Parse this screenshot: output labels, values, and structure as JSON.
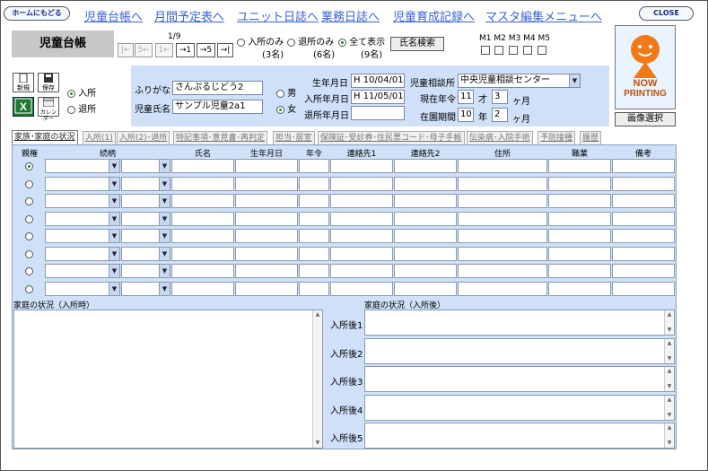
{
  "nav": {
    "home_label": "ホームにもどる",
    "close_label": "CLOSE",
    "links": [
      "児童台帳へ",
      "月間予定表へ",
      "ユニット日誌へ",
      "業務日誌へ",
      "児童育成記録へ",
      "マスタ編集メニューへ"
    ]
  },
  "page_title": "児童台帳",
  "pager": {
    "count": "1/9",
    "buttons": [
      "|←",
      "5←",
      "1←",
      "→1",
      "→5",
      "→|"
    ]
  },
  "filter": {
    "options": [
      {
        "label": "入所のみ",
        "count": "(3名)",
        "checked": false
      },
      {
        "label": "退所のみ",
        "count": "(6名)",
        "checked": false
      },
      {
        "label": "全て表示",
        "count": "(9名)",
        "checked": true
      }
    ],
    "search_button": "氏名検索"
  },
  "m_checks": [
    "M1",
    "M2",
    "M3",
    "M4",
    "M5"
  ],
  "tools": {
    "new_label": "新規",
    "save_label": "保存",
    "calendar_label": "カレンダー",
    "status_options": [
      {
        "label": "入所",
        "checked": true
      },
      {
        "label": "退所",
        "checked": false
      }
    ]
  },
  "info": {
    "furigana_label": "ふりがな",
    "furigana_value": "さんぷるじどう2",
    "name_label": "児童氏名",
    "name_value": "サンプル児童2a1",
    "gender": [
      {
        "label": "男",
        "checked": false
      },
      {
        "label": "女",
        "checked": true
      }
    ],
    "birth_label": "生年月日",
    "birth_value": "H 10/04/01",
    "admission_label": "入所年月日",
    "admission_value": "H 11/05/01",
    "leave_label": "退所年月日",
    "leave_value": "",
    "center_label": "児童相談所",
    "center_value": "中央児童相談センター",
    "age_label": "現在年令",
    "age_years": "11",
    "age_years_unit": "才",
    "age_months": "3",
    "age_months_unit": "ヶ月",
    "stay_label": "在園期間",
    "stay_years": "10",
    "stay_years_unit": "年",
    "stay_months": "2",
    "stay_months_unit": "ヶ月"
  },
  "image": {
    "now_text": "NOW",
    "printing_text": "PRINTING",
    "select_button": "画像選択"
  },
  "tabs": [
    "家族･家庭の状況",
    "入所(1)",
    "入所(2)･退所",
    "特記事項･意見書･再判定",
    "担当･居室",
    "保険証･受診券･住民票コード･母子手帳",
    "伝染病･入院手術",
    "予防接種",
    "履歴"
  ],
  "family_table": {
    "headers": [
      "親権",
      "続柄",
      "氏名",
      "生年月日",
      "年令",
      "連絡先1",
      "連絡先2",
      "住所",
      "職業",
      "備考"
    ],
    "row_count": 8,
    "checked_row": 0
  },
  "situation": {
    "before_label": "家庭の状況（入所時）",
    "after_label": "家庭の状況（入所後）",
    "after_rows": [
      "入所後1",
      "入所後2",
      "入所後3",
      "入所後4",
      "入所後5"
    ]
  },
  "colors": {
    "panel_bg": "#cfe0f8",
    "link": "#3c62d8",
    "accent_orange": "#f07a1a"
  }
}
